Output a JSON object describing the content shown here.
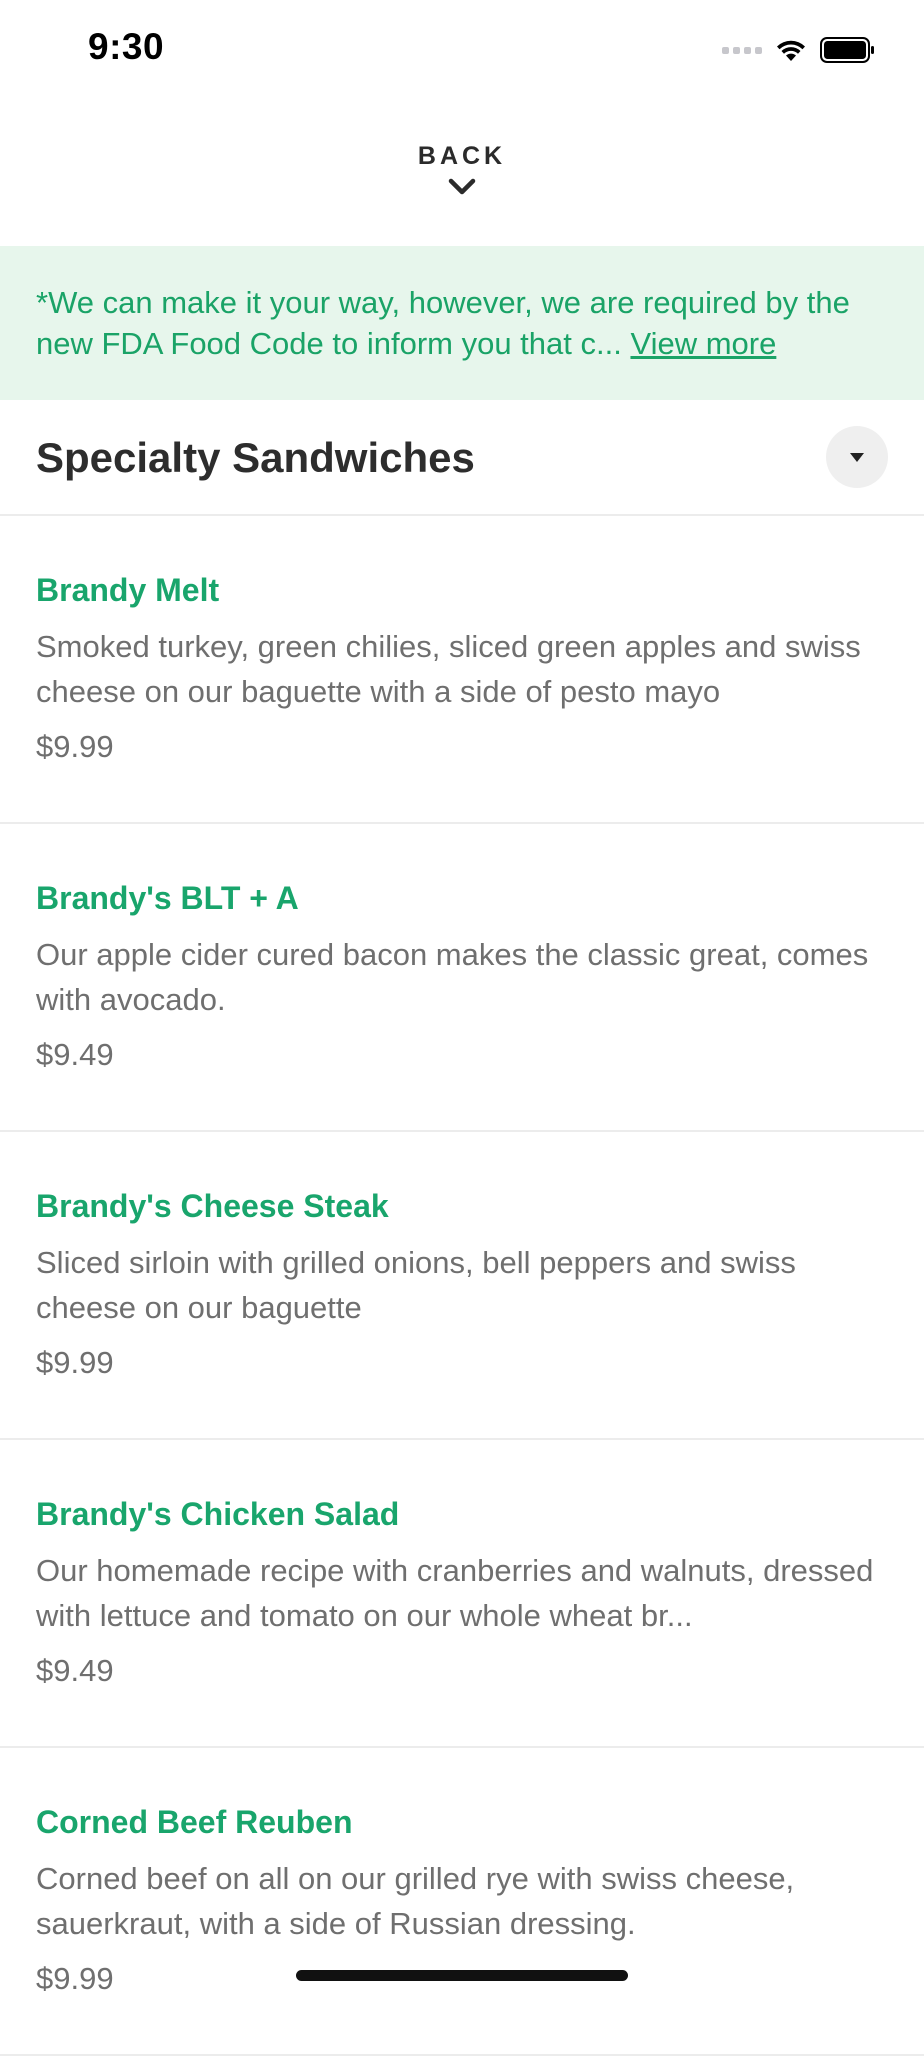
{
  "status_bar": {
    "time": "9:30"
  },
  "nav": {
    "back_label": "BACK"
  },
  "notice": {
    "text": "*We can make it your way, however, we are required by the new FDA Food Code to inform you that c...",
    "link_label": "View more"
  },
  "section": {
    "title": "Specialty Sandwiches"
  },
  "items": [
    {
      "name": "Brandy Melt",
      "description": "Smoked turkey, green chilies, sliced green apples and swiss cheese on our baguette with a side of pesto mayo",
      "price": "$9.99"
    },
    {
      "name": "Brandy's BLT + A",
      "description": "Our apple cider cured bacon makes the classic great, comes with avocado.",
      "price": "$9.49"
    },
    {
      "name": "Brandy's Cheese Steak",
      "description": "Sliced sirloin with grilled onions, bell peppers and swiss cheese on our baguette",
      "price": "$9.99"
    },
    {
      "name": "Brandy's Chicken Salad",
      "description": "Our homemade recipe with cranberries and walnuts, dressed with lettuce and tomato on our whole wheat br...",
      "price": "$9.49"
    },
    {
      "name": "Corned Beef Reuben",
      "description": "Corned beef on all on our grilled rye with swiss cheese, sauerkraut, with a side of Russian dressing.",
      "price": "$9.99"
    }
  ],
  "colors": {
    "accent_green": "#19a56c",
    "notice_background": "#e7f6ec",
    "body_text": "#6f6f6f"
  },
  "icons": {
    "back": "chevron-down-icon",
    "section_toggle": "caret-down-icon",
    "status": [
      "cellular-signal-icon",
      "wifi-icon",
      "battery-icon"
    ]
  }
}
